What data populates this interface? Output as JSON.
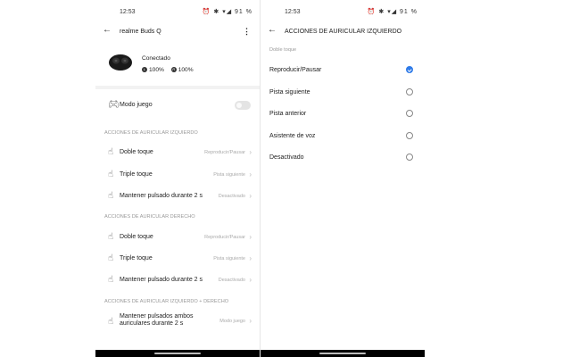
{
  "left": {
    "status": {
      "time": "12:53",
      "icons": "⏰ ✱ ▾◢ 91 %"
    },
    "appbar": {
      "title": "realme Buds Q"
    },
    "device": {
      "connection": "Conectado",
      "battery_left": "100%",
      "battery_right": "100%"
    },
    "game_mode": {
      "label": "Modo juego"
    },
    "sections": [
      {
        "title": "ACCIONES DE AURICULAR IZQUIERDO",
        "rows": [
          {
            "label": "Doble toque",
            "value": "Reproducir/Pausar"
          },
          {
            "label": "Triple toque",
            "value": "Pista siguiente"
          },
          {
            "label": "Mantener pulsado durante 2 s",
            "value": "Desactivado"
          }
        ]
      },
      {
        "title": "ACCIONES DE AURICULAR DERECHO",
        "rows": [
          {
            "label": "Doble toque",
            "value": "Reproducir/Pausar"
          },
          {
            "label": "Triple toque",
            "value": "Pista siguiente"
          },
          {
            "label": "Mantener pulsado durante 2 s",
            "value": "Desactivado"
          }
        ]
      },
      {
        "title": "ACCIONES DE AURICULAR IZQUIERDO + DERECHO",
        "rows": [
          {
            "label_line1": "Mantener pulsados ambos",
            "label_line2": "auriculares durante 2 s",
            "value": "Modo juego"
          }
        ]
      }
    ]
  },
  "right": {
    "status": {
      "time": "12:53",
      "icons": "⏰ ✱ ▾◢ 91 %"
    },
    "appbar": {
      "title": "ACCIONES DE AURICULAR IZQUIERDO"
    },
    "group_title": "Doble toque",
    "options": [
      {
        "label": "Reproducir/Pausar",
        "selected": true
      },
      {
        "label": "Pista siguiente",
        "selected": false
      },
      {
        "label": "Pista anterior",
        "selected": false
      },
      {
        "label": "Asistente de voz",
        "selected": false
      },
      {
        "label": "Desactivado",
        "selected": false
      }
    ],
    "accent": "#2f7be8"
  }
}
